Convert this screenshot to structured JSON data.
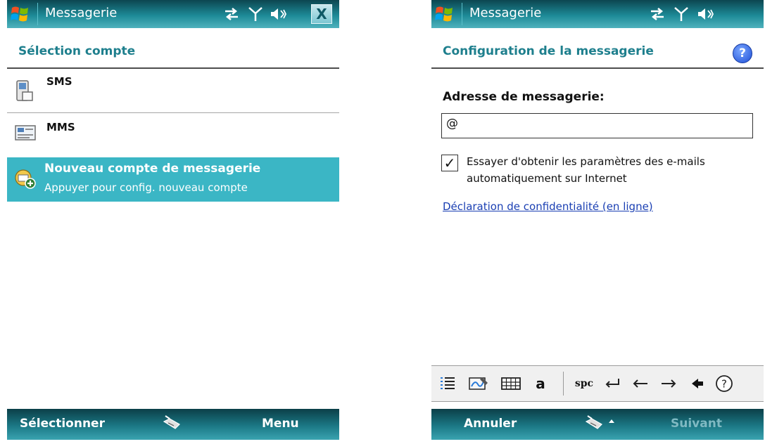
{
  "left_screen": {
    "titlebar": {
      "title": "Messagerie",
      "close_label": "X"
    },
    "header": {
      "title": "Sélection compte"
    },
    "accounts": [
      {
        "label": "SMS",
        "icon": "sms-icon"
      },
      {
        "label": "MMS",
        "icon": "mms-icon"
      },
      {
        "label": "Nouveau compte de messagerie",
        "sub": "Appuyer pour config. nouveau compte",
        "icon": "new-email-account-icon",
        "selected": true
      }
    ],
    "softkeys": {
      "left": "Sélectionner",
      "right": "Menu"
    }
  },
  "right_screen": {
    "titlebar": {
      "title": "Messagerie"
    },
    "header": {
      "title": "Configuration de la messagerie",
      "help_label": "?"
    },
    "email_label": "Adresse de messagerie:",
    "email_value": "@",
    "auto_settings": {
      "checked": true,
      "text": "Essayer d'obtenir les paramètres des e-mails automatiquement sur Internet"
    },
    "privacy_link": "Déclaration de confidentialité (en ligne)",
    "sip_toolbar": {
      "letter_key": "a",
      "space_key": "spc",
      "help_key": "?"
    },
    "softkeys": {
      "left": "Annuler",
      "right": "Suivant",
      "right_disabled": true
    }
  },
  "colors": {
    "titlebar": "#1d8a97",
    "header_text": "#1e7f8d",
    "selection": "#3bb6c5",
    "link": "#1a3fb3",
    "softbar": "#1b7885"
  }
}
